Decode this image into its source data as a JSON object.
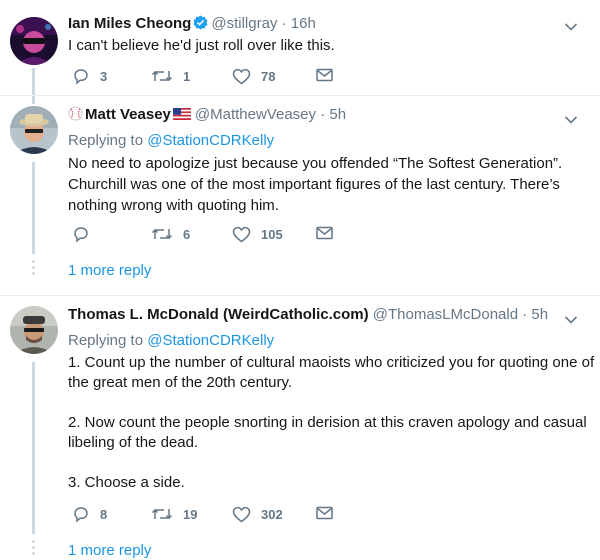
{
  "tweets": [
    {
      "name": "Ian Miles Cheong",
      "handle": "@stillgray",
      "time": "16h",
      "verified": true,
      "lines": [
        "I can't believe he'd just roll over like this."
      ],
      "replies": "3",
      "retweets": "1",
      "likes": "78"
    },
    {
      "name": "Matt Veasey",
      "name_prefix_icon": "baseball-icon",
      "name_suffix_icon": "us-flag-icon",
      "handle": "@MatthewVeasey",
      "time": "5h",
      "reply_label": "Replying to",
      "reply_to": "@StationCDRKelly",
      "lines": [
        "No need to apologize just because you offended “The Softest Generation”.",
        "Churchill was one of the most important figures of the last century. There’s",
        "nothing wrong with quoting him."
      ],
      "replies": "",
      "retweets": "6",
      "likes": "105",
      "more_replies": "1 more reply"
    },
    {
      "name": "Thomas L. McDonald (WeirdCatholic.com)",
      "handle": "@ThomasLMcDonald",
      "time": "5h",
      "reply_label": "Replying to",
      "reply_to": "@StationCDRKelly",
      "lines": [
        "1. Count up the number of cultural maoists who criticized you for quoting one of",
        "the great men of the 20th century.",
        "",
        "2. Now count the people snorting in derision at this craven apology and casual",
        "libeling of the dead.",
        "",
        "3. Choose a side."
      ],
      "replies": "8",
      "retweets": "19",
      "likes": "302",
      "more_replies": "1 more reply"
    }
  ],
  "separator": "·",
  "colors": {
    "link": "#1b95e0",
    "muted": "#657786",
    "text": "#14171a",
    "verified": "#1da1f2"
  }
}
